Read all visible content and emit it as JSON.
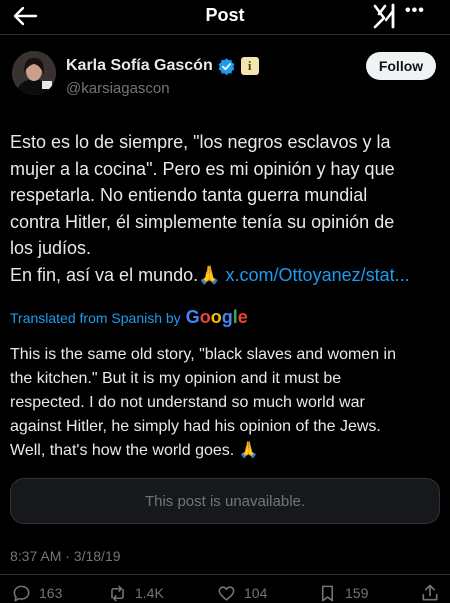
{
  "header": {
    "title": "Post",
    "back_icon": "arrow-left-icon",
    "grok_icon": "grok-icon",
    "more_label": "•••"
  },
  "author": {
    "name": "Karla Sofía Gascón",
    "handle": "@karsiagascon",
    "verified_icon": "verified-badge-icon",
    "affiliate_badge": "i",
    "follow_label": "Follow"
  },
  "tweet": {
    "lines": [
      "Esto es lo de siempre, \"los negros esclavos y la",
      "mujer a la cocina\". Pero es mi opinión y hay que",
      "respetarla. No entiendo tanta guerra mundial",
      "contra Hitler, él simplemente tenía su opinión de",
      "los judíos."
    ],
    "last_line_text": "En fin, así va el mundo.",
    "emoji": "🙏",
    "link": "x.com/Ottoyanez/stat..."
  },
  "translation": {
    "label": "Translated from Spanish by",
    "provider": "Google",
    "lines": [
      "This is the same old story, \"black slaves and women in",
      "the kitchen.\" But it is my opinion and it must be",
      "respected. I do not understand so much world war",
      "against Hitler, he simply had his opinion of the Jews.",
      "Well, that's how the world goes."
    ],
    "emoji": "🙏"
  },
  "quoted": {
    "message": "This post is unavailable."
  },
  "meta": {
    "timestamp": "8:37 AM · 3/18/19"
  },
  "actions": {
    "replies": "163",
    "reposts": "1.4K",
    "likes": "104",
    "bookmarks": "159"
  },
  "colors": {
    "background": "#000000",
    "link": "#1d9bf0",
    "secondary_text": "#71767b",
    "primary_text": "#e7e9ea"
  }
}
